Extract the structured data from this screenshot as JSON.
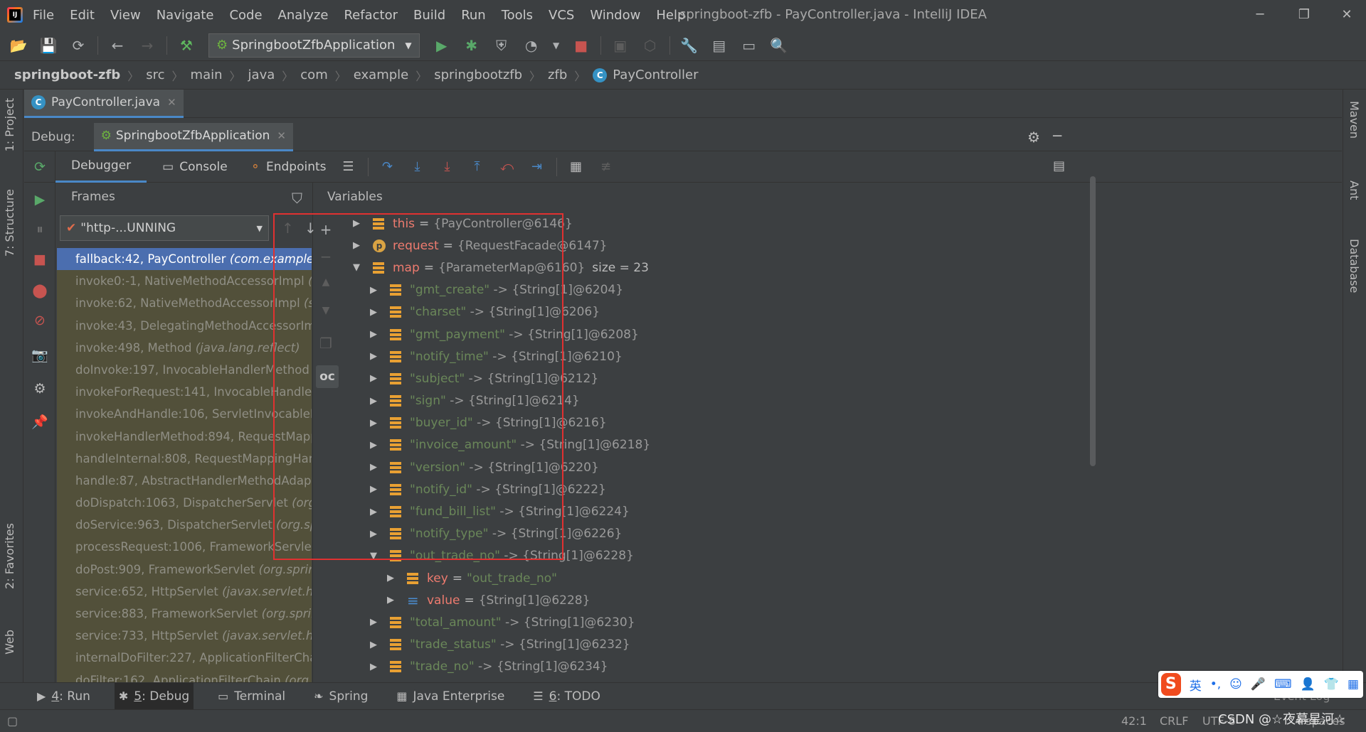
{
  "menu": [
    "File",
    "Edit",
    "View",
    "Navigate",
    "Code",
    "Analyze",
    "Refactor",
    "Build",
    "Run",
    "Tools",
    "VCS",
    "Window",
    "Help"
  ],
  "window_title": "springboot-zfb - PayController.java - IntelliJ IDEA",
  "window_controls": {
    "minimize": "─",
    "maximize": "❐",
    "close": "✕"
  },
  "run_config": "SpringbootZfbApplication",
  "breadcrumb": [
    "springboot-zfb",
    "src",
    "main",
    "java",
    "com",
    "example",
    "springbootzfb",
    "zfb",
    "PayController"
  ],
  "editor_tab": {
    "label": "PayController.java",
    "icon_letter": "C"
  },
  "left_tabs": {
    "project": "1: Project",
    "structure": "7: Structure",
    "favorites": "2: Favorites",
    "web": "Web"
  },
  "right_tabs": {
    "maven": "Maven",
    "ant": "Ant",
    "database": "Database"
  },
  "debug": {
    "label": "Debug:",
    "session": "SpringbootZfbApplication",
    "tabs": {
      "debugger": "Debugger",
      "console": "Console",
      "endpoints": "Endpoints"
    }
  },
  "frames": {
    "title": "Frames",
    "thread": "\"http-...UNNING",
    "items": [
      {
        "method": "fallback:42, PayController",
        "pkg": "(com.example."
      },
      {
        "method": "invoke0:-1, NativeMethodAccessorImpl",
        "pkg": "(s"
      },
      {
        "method": "invoke:62, NativeMethodAccessorImpl",
        "pkg": "(s"
      },
      {
        "method": "invoke:43, DelegatingMethodAccessorIm",
        "pkg": ""
      },
      {
        "method": "invoke:498, Method",
        "pkg": "(java.lang.reflect)"
      },
      {
        "method": "doInvoke:197, InvocableHandlerMethod",
        "pkg": ""
      },
      {
        "method": "invokeForRequest:141, InvocableHandler",
        "pkg": ""
      },
      {
        "method": "invokeAndHandle:106, ServletInvocableH",
        "pkg": ""
      },
      {
        "method": "invokeHandlerMethod:894, RequestMapp",
        "pkg": ""
      },
      {
        "method": "handleInternal:808, RequestMappingHand",
        "pkg": ""
      },
      {
        "method": "handle:87, AbstractHandlerMethodAdapt",
        "pkg": ""
      },
      {
        "method": "doDispatch:1063, DispatcherServlet",
        "pkg": "(org."
      },
      {
        "method": "doService:963, DispatcherServlet",
        "pkg": "(org.spr"
      },
      {
        "method": "processRequest:1006, FrameworkServlet",
        "pkg": ""
      },
      {
        "method": "doPost:909, FrameworkServlet",
        "pkg": "(org.spring"
      },
      {
        "method": "service:652, HttpServlet",
        "pkg": "(javax.servlet.http"
      },
      {
        "method": "service:883, FrameworkServlet",
        "pkg": "(org.spring"
      },
      {
        "method": "service:733, HttpServlet",
        "pkg": "(javax.servlet.http"
      },
      {
        "method": "internalDoFilter:227, ApplicationFilterCha",
        "pkg": ""
      },
      {
        "method": "doFilter:162, ApplicationFilterChain",
        "pkg": "(org."
      }
    ]
  },
  "variables": {
    "title": "Variables",
    "items": [
      {
        "indent": 0,
        "expand": "right",
        "icon": "field",
        "name": "this",
        "value": "{PayController@6146}"
      },
      {
        "indent": 0,
        "expand": "right",
        "icon": "p",
        "name": "request",
        "value": "{RequestFacade@6147}"
      },
      {
        "indent": 0,
        "expand": "down",
        "icon": "field",
        "name": "map",
        "value": "{ParameterMap@6160}",
        "size": "size = 23"
      },
      {
        "indent": 1,
        "expand": "right",
        "icon": "field",
        "key": "\"gmt_create\"",
        "value": "-> {String[1]@6204}"
      },
      {
        "indent": 1,
        "expand": "right",
        "icon": "field",
        "key": "\"charset\"",
        "value": "-> {String[1]@6206}"
      },
      {
        "indent": 1,
        "expand": "right",
        "icon": "field",
        "key": "\"gmt_payment\"",
        "value": "-> {String[1]@6208}"
      },
      {
        "indent": 1,
        "expand": "right",
        "icon": "field",
        "key": "\"notify_time\"",
        "value": "-> {String[1]@6210}"
      },
      {
        "indent": 1,
        "expand": "right",
        "icon": "field",
        "key": "\"subject\"",
        "value": "-> {String[1]@6212}"
      },
      {
        "indent": 1,
        "expand": "right",
        "icon": "field",
        "key": "\"sign\"",
        "value": "-> {String[1]@6214}"
      },
      {
        "indent": 1,
        "expand": "right",
        "icon": "field",
        "key": "\"buyer_id\"",
        "value": "-> {String[1]@6216}"
      },
      {
        "indent": 1,
        "expand": "right",
        "icon": "field",
        "key": "\"invoice_amount\"",
        "value": "-> {String[1]@6218}"
      },
      {
        "indent": 1,
        "expand": "right",
        "icon": "field",
        "key": "\"version\"",
        "value": "-> {String[1]@6220}"
      },
      {
        "indent": 1,
        "expand": "right",
        "icon": "field",
        "key": "\"notify_id\"",
        "value": "-> {String[1]@6222}"
      },
      {
        "indent": 1,
        "expand": "right",
        "icon": "field",
        "key": "\"fund_bill_list\"",
        "value": "-> {String[1]@6224}"
      },
      {
        "indent": 1,
        "expand": "right",
        "icon": "field",
        "key": "\"notify_type\"",
        "value": "-> {String[1]@6226}"
      },
      {
        "indent": 1,
        "expand": "down",
        "icon": "field",
        "key": "\"out_trade_no\"",
        "value": "-> {String[1]@6228}"
      },
      {
        "indent": 2,
        "expand": "right",
        "icon": "field",
        "name": "key",
        "strval": "\"out_trade_no\""
      },
      {
        "indent": 2,
        "expand": "right",
        "icon": "array",
        "name": "value",
        "value": "{String[1]@6228}"
      },
      {
        "indent": 1,
        "expand": "right",
        "icon": "field",
        "key": "\"total_amount\"",
        "value": "-> {String[1]@6230}"
      },
      {
        "indent": 1,
        "expand": "right",
        "icon": "field",
        "key": "\"trade_status\"",
        "value": "-> {String[1]@6232}"
      },
      {
        "indent": 1,
        "expand": "right",
        "icon": "field",
        "key": "\"trade_no\"",
        "value": "-> {String[1]@6234}"
      }
    ]
  },
  "bottom_tabs": [
    {
      "num": "4",
      "label": ": Run",
      "icon": "▶"
    },
    {
      "num": "5",
      "label": ": Debug",
      "icon": "✱",
      "active": true
    },
    {
      "num": "",
      "label": "Terminal",
      "icon": "▭"
    },
    {
      "num": "",
      "label": "Spring",
      "icon": "❧"
    },
    {
      "num": "",
      "label": "Java Enterprise",
      "icon": "▦"
    },
    {
      "num": "6",
      "label": ": TODO",
      "icon": "☰"
    }
  ],
  "event_log": "Event Log",
  "status": {
    "position": "42:1",
    "line_sep": "CRLF",
    "encoding": "UTF-8",
    "indent": "4 spaces"
  },
  "ime": {
    "logo": "S",
    "lang": "英"
  },
  "watermark": "CSDN @☆夜幕星河☆",
  "colors": {
    "highlight_box": "#e03131",
    "selected_frame": "#4b6eaf",
    "accent": "#4a88c7"
  }
}
